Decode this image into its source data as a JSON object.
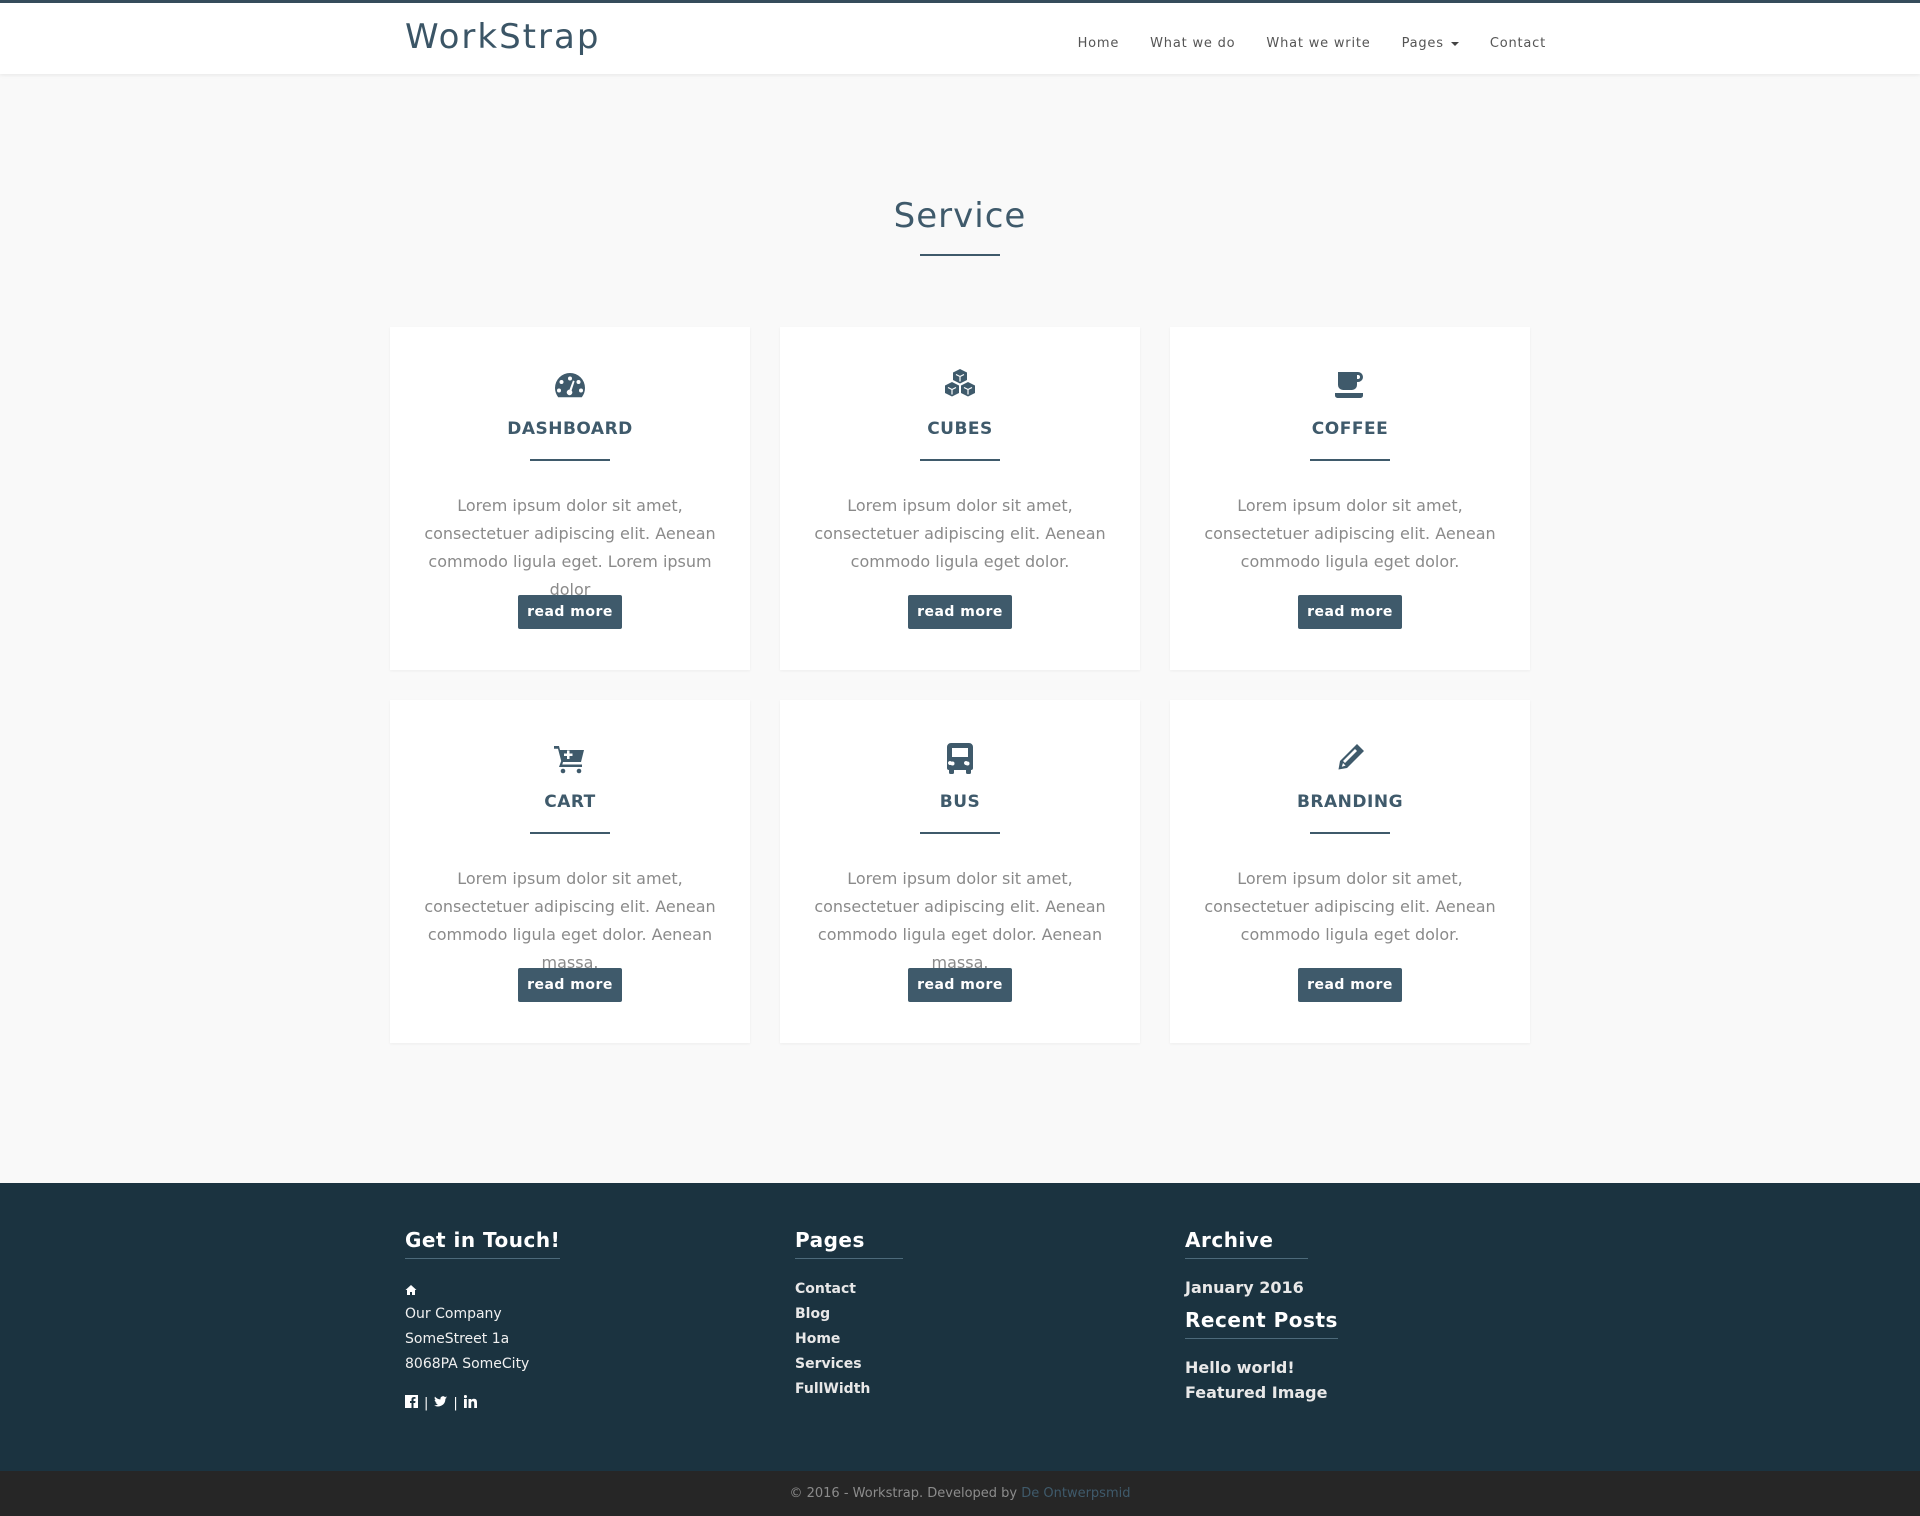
{
  "brand": "WorkStrap",
  "nav": {
    "home": "Home",
    "what_we_do": "What we do",
    "what_we_write": "What we write",
    "pages": "Pages",
    "contact": "Contact"
  },
  "service": {
    "title": "Service",
    "cards": [
      {
        "title": "DASHBOARD",
        "icon": "dashboard-icon",
        "text": "Lorem ipsum dolor sit amet, consectetuer adipiscing elit. Aenean commodo ligula eget. Lorem ipsum dolor",
        "button": "read more"
      },
      {
        "title": "CUBES",
        "icon": "cubes-icon",
        "text": "Lorem ipsum dolor sit amet, consectetuer adipiscing elit. Aenean commodo ligula eget dolor.",
        "button": "read more"
      },
      {
        "title": "COFFEE",
        "icon": "coffee-icon",
        "text": "Lorem ipsum dolor sit amet, consectetuer adipiscing elit. Aenean commodo ligula eget dolor.",
        "button": "read more"
      },
      {
        "title": "CART",
        "icon": "cart-plus-icon",
        "text": "Lorem ipsum dolor sit amet, consectetuer adipiscing elit. Aenean commodo ligula eget dolor. Aenean massa.",
        "button": "read more"
      },
      {
        "title": "BUS",
        "icon": "bus-icon",
        "text": "Lorem ipsum dolor sit amet, consectetuer adipiscing elit. Aenean commodo ligula eget dolor. Aenean massa.",
        "button": "read more"
      },
      {
        "title": "BRANDING",
        "icon": "pencil-icon",
        "text": "Lorem ipsum dolor sit amet, consectetuer adipiscing elit. Aenean commodo ligula eget dolor.",
        "button": "read more"
      }
    ]
  },
  "footer": {
    "touch": {
      "title": "Get in Touch!",
      "company": "Our Company",
      "street": "SomeStreet 1a",
      "city": "8068PA SomeCity",
      "sep": "|"
    },
    "pages": {
      "title": "Pages",
      "links": [
        "Contact",
        "Blog",
        "Home",
        "Services",
        "FullWidth"
      ]
    },
    "archive": {
      "title": "Archive",
      "month": "January 2016"
    },
    "recent": {
      "title": "Recent Posts",
      "posts": [
        "Hello world!",
        "Featured Image"
      ]
    }
  },
  "copyright": {
    "text": "© 2016 - Workstrap. Developed by ",
    "link": "De Ontwerpsmid"
  },
  "colors": {
    "accent": "#3f5a6b",
    "footer_bg": "#1b3340",
    "bottom_bar_bg": "#262626",
    "page_bg": "#f9f9f9"
  }
}
